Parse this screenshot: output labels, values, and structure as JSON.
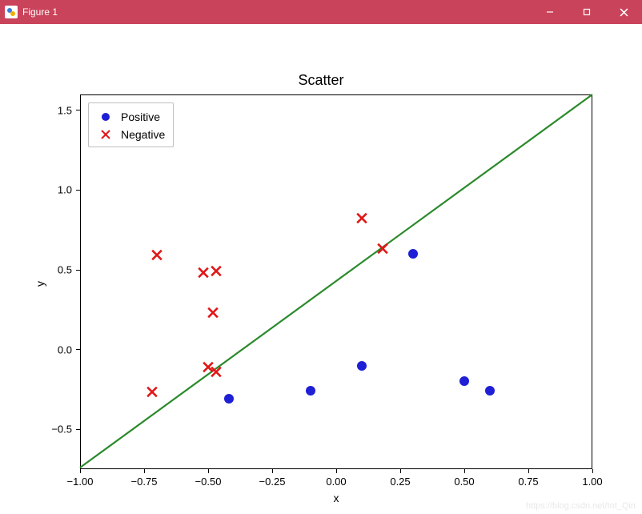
{
  "window": {
    "title": "Figure 1"
  },
  "chart_data": {
    "type": "scatter",
    "title": "Scatter",
    "xlabel": "x",
    "ylabel": "y",
    "xlim": [
      -1.0,
      1.0
    ],
    "ylim": [
      -0.75,
      1.6
    ],
    "xticks": [
      -1.0,
      -0.75,
      -0.5,
      -0.25,
      0.0,
      0.25,
      0.5,
      0.75,
      1.0
    ],
    "yticks": [
      -0.5,
      0.0,
      0.5,
      1.0,
      1.5
    ],
    "xtick_labels": [
      "−1.00",
      "−0.75",
      "−0.50",
      "−0.25",
      "0.00",
      "0.25",
      "0.50",
      "0.75",
      "1.00"
    ],
    "ytick_labels": [
      "−0.5",
      "0.0",
      "0.5",
      "1.0",
      "1.5"
    ],
    "series": [
      {
        "name": "Positive",
        "marker": "circle",
        "color": "#1f1fd6",
        "points": [
          {
            "x": -0.42,
            "y": -0.31
          },
          {
            "x": -0.1,
            "y": -0.26
          },
          {
            "x": 0.1,
            "y": -0.1
          },
          {
            "x": 0.3,
            "y": 0.6
          },
          {
            "x": 0.5,
            "y": -0.2
          },
          {
            "x": 0.6,
            "y": -0.26
          }
        ]
      },
      {
        "name": "Negative",
        "marker": "x",
        "color": "#e11717",
        "points": [
          {
            "x": -0.7,
            "y": 0.58
          },
          {
            "x": -0.72,
            "y": -0.28
          },
          {
            "x": -0.52,
            "y": 0.47
          },
          {
            "x": -0.47,
            "y": 0.48
          },
          {
            "x": -0.48,
            "y": 0.22
          },
          {
            "x": -0.5,
            "y": -0.12
          },
          {
            "x": -0.47,
            "y": -0.15
          },
          {
            "x": 0.1,
            "y": 0.81
          },
          {
            "x": 0.18,
            "y": 0.62
          }
        ]
      }
    ],
    "line": {
      "color": "#2b8a2b",
      "p1": {
        "x": -1.0,
        "y": -0.74
      },
      "p2": {
        "x": 1.0,
        "y": 1.6
      }
    },
    "legend": {
      "position": "upper-left",
      "items": [
        {
          "label": "Positive"
        },
        {
          "label": "Negative"
        }
      ]
    }
  },
  "watermark": "https://blog.csdn.net/Int_Qin"
}
